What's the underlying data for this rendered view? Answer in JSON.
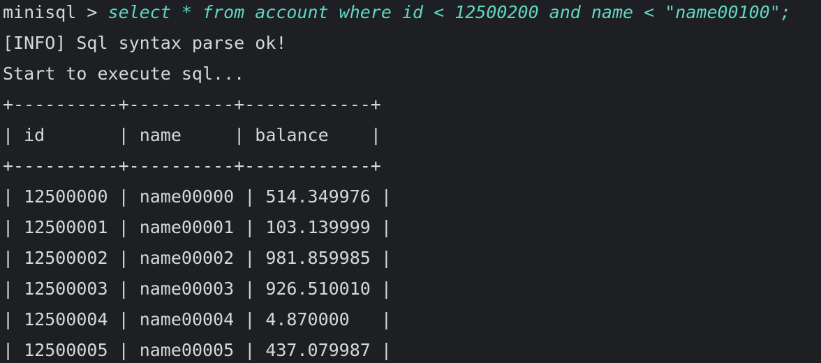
{
  "terminal": {
    "prompt": "minisql > ",
    "command": "select * from account where id < 12500200 and name < \"name00100\";",
    "output": [
      "[INFO] Sql syntax parse ok!",
      "Start to execute sql..."
    ],
    "table": {
      "border": "+----------+----------+------------+",
      "columns": [
        "id",
        "name",
        "balance"
      ],
      "rows": [
        [
          "12500000",
          "name00000",
          "514.349976"
        ],
        [
          "12500001",
          "name00001",
          "103.139999"
        ],
        [
          "12500002",
          "name00002",
          "981.859985"
        ],
        [
          "12500003",
          "name00003",
          "926.510010"
        ],
        [
          "12500004",
          "name00004",
          "4.870000"
        ],
        [
          "12500005",
          "name00005",
          "437.079987"
        ]
      ]
    }
  },
  "colors": {
    "background": "#1e1f22",
    "text": "#d5d7dc",
    "command": "#5fd8c4"
  }
}
